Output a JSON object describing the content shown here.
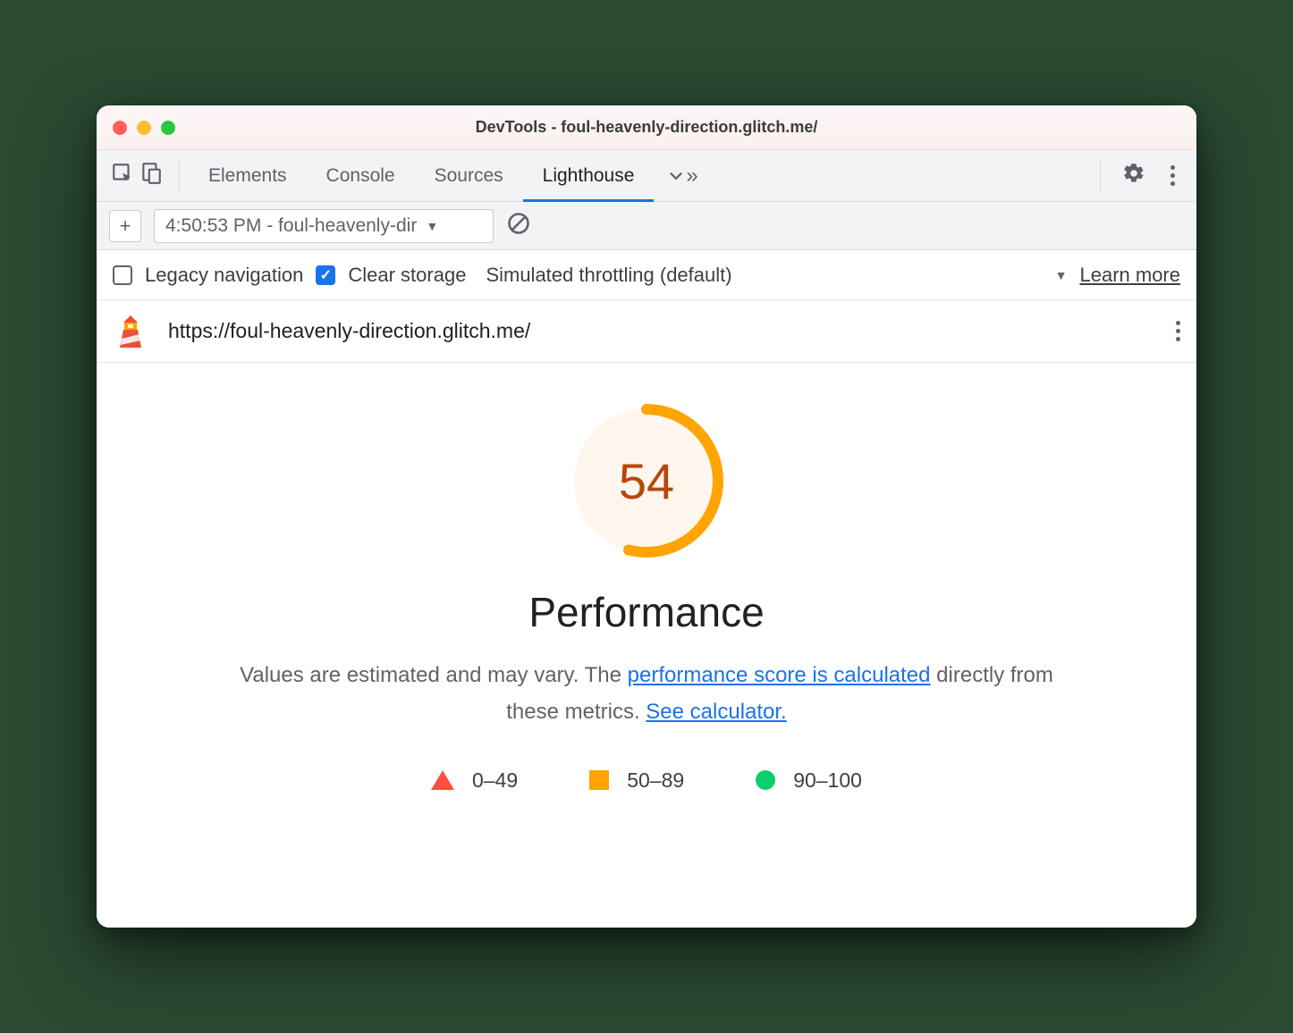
{
  "titlebar": {
    "title": "DevTools - foul-heavenly-direction.glitch.me/"
  },
  "tabs": {
    "items": [
      "Elements",
      "Console",
      "Sources",
      "Lighthouse"
    ],
    "active": "Lighthouse"
  },
  "secondary": {
    "report_label": "4:50:53 PM - foul-heavenly-dir"
  },
  "options": {
    "legacy_label": "Legacy navigation",
    "legacy_checked": false,
    "clear_label": "Clear storage",
    "clear_checked": true,
    "throttling_label": "Simulated throttling (default)",
    "learn_more": "Learn more"
  },
  "url_row": {
    "url": "https://foul-heavenly-direction.glitch.me/"
  },
  "report": {
    "score": "54",
    "score_pct": 54,
    "category": "Performance",
    "desc_pre": "Values are estimated and may vary. The ",
    "link1": "performance score is calculated",
    "desc_mid": " directly from these metrics. ",
    "link2": "See calculator.",
    "legend": {
      "r1": "0–49",
      "r2": "50–89",
      "r3": "90–100"
    }
  },
  "colors": {
    "accent": "#1a73e8",
    "warn": "#ffa400",
    "fail": "#ff4e42",
    "pass": "#0cce6b"
  }
}
